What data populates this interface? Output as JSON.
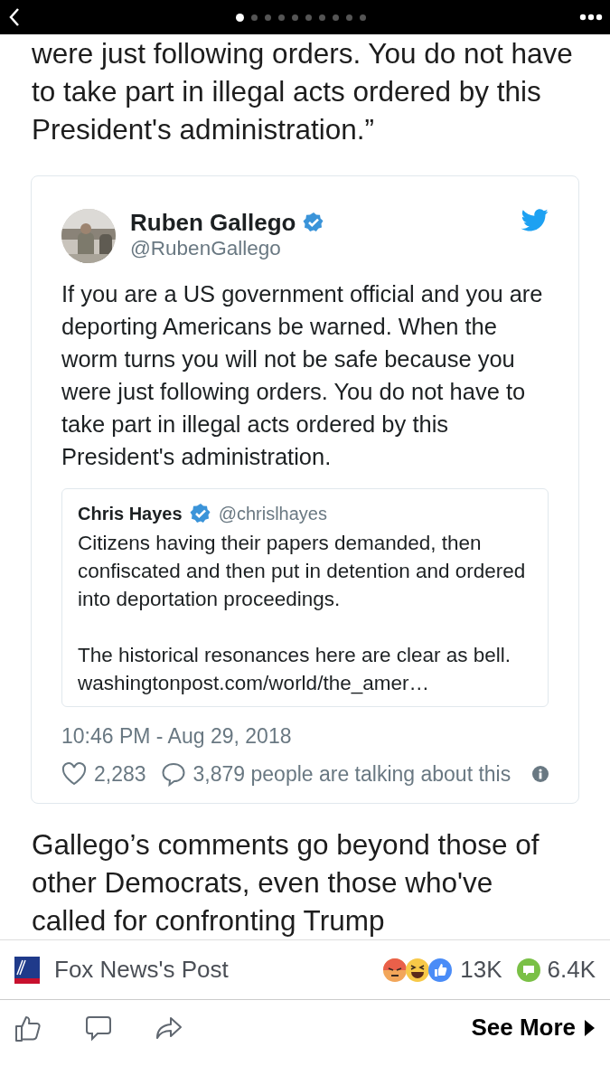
{
  "top_bar": {
    "pages": [
      {
        "selected": true
      },
      {
        "selected": false
      },
      {
        "selected": false
      },
      {
        "selected": false
      },
      {
        "selected": false
      },
      {
        "selected": false
      },
      {
        "selected": false
      },
      {
        "selected": false
      },
      {
        "selected": false
      },
      {
        "selected": false
      }
    ]
  },
  "intro_text": "were just following orders. You do not have to take part in illegal acts ordered by this President's administration.”",
  "tweet": {
    "name": "Ruben Gallego",
    "verified": true,
    "handle": "@RubenGallego",
    "text": "If you are a US government official and you are deporting Americans be warned. When the worm turns you will not be safe because you were just following orders. You do not have to take part in illegal acts ordered by this President's administration.",
    "quoted": {
      "name": "Chris Hayes",
      "verified": true,
      "handle": "@chrislhayes",
      "paragraphs": [
        "Citizens having their papers demanded, then confiscated and then put in detention and ordered into deportation proceedings.",
        "The historical resonances here are clear as bell."
      ],
      "link": "washingtonpost.com/world/the_amer…"
    },
    "timestamp": "10:46 PM - Aug 29, 2018",
    "likes": "2,283",
    "talking": "3,879 people are talking about this"
  },
  "outro_text": "Gallego’s comments go beyond those of other Democrats, even those who've called for confronting Trump",
  "post_bar": {
    "source": "Fox News's Post",
    "reactions": [
      {
        "kind": "angry"
      },
      {
        "kind": "haha"
      },
      {
        "kind": "like"
      }
    ],
    "reaction_count": "13K",
    "comment_count": "6.4K"
  },
  "actions": {
    "see_more": "See More"
  }
}
